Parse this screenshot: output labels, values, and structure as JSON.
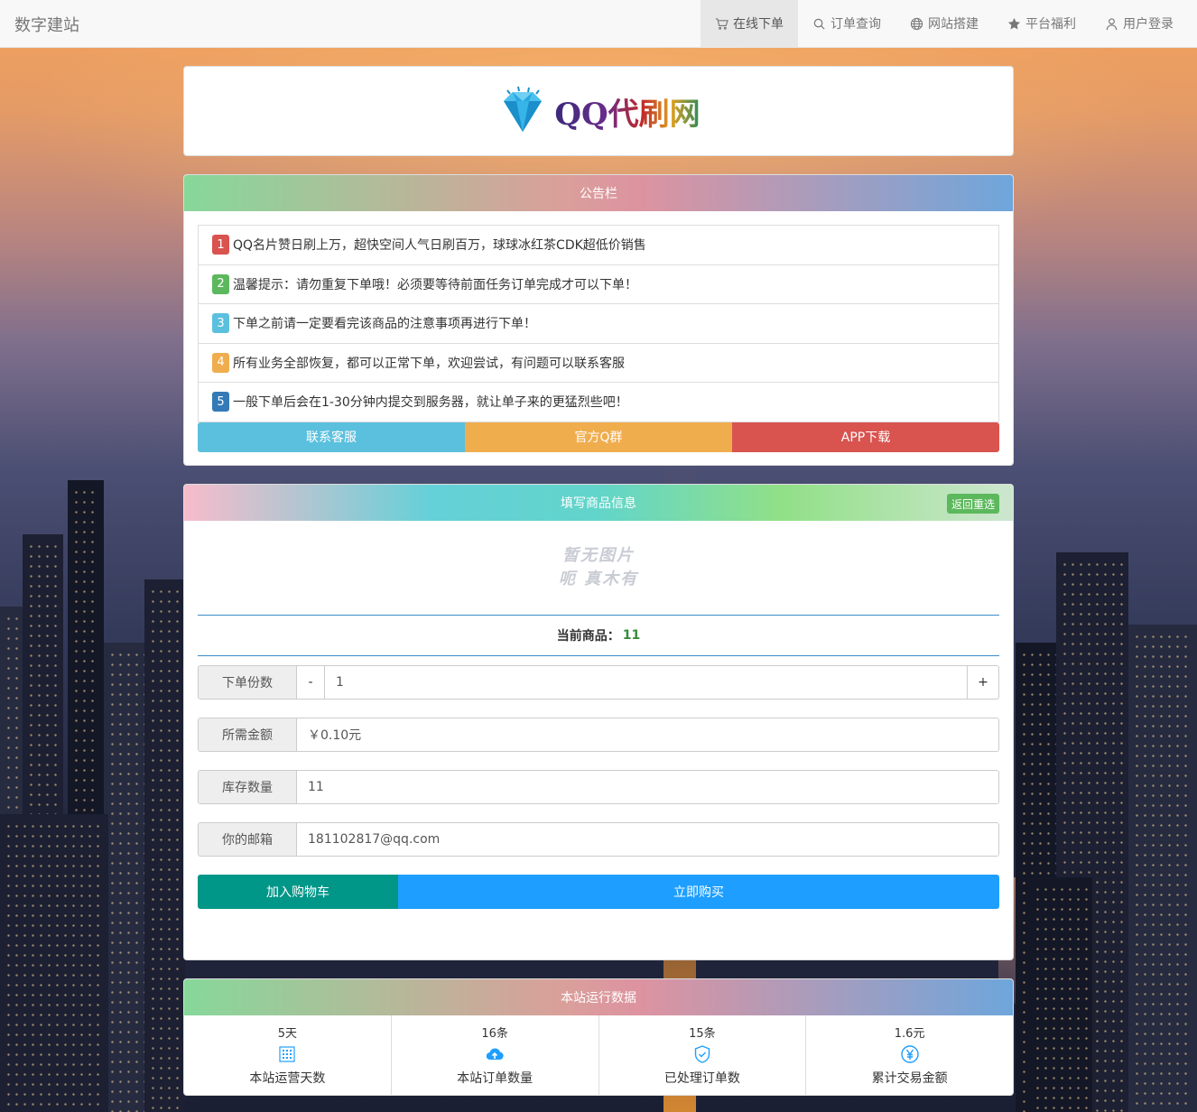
{
  "navbar": {
    "brand": "数字建站",
    "items": [
      {
        "label": "在线下单",
        "icon": "cart-icon",
        "active": true
      },
      {
        "label": "订单查询",
        "icon": "search-icon"
      },
      {
        "label": "网站搭建",
        "icon": "globe-icon"
      },
      {
        "label": "平台福利",
        "icon": "star-icon"
      },
      {
        "label": "用户登录",
        "icon": "user-icon"
      }
    ]
  },
  "logo": {
    "text": "QQ代刷网",
    "icon": "diamond-icon"
  },
  "notice": {
    "title": "公告栏",
    "items": [
      {
        "num": "1",
        "color": "#d9534f",
        "text": "QQ名片赞日刷上万，超快空间人气日刷百万，球球冰红茶CDK超低价销售"
      },
      {
        "num": "2",
        "color": "#5cb85c",
        "text": "温馨提示：请勿重复下单哦！必须要等待前面任务订单完成才可以下单！"
      },
      {
        "num": "3",
        "color": "#5bc0de",
        "text": "下单之前请一定要看完该商品的注意事项再进行下单！"
      },
      {
        "num": "4",
        "color": "#f0ad4e",
        "text": "所有业务全部恢复，都可以正常下单，欢迎尝试，有问题可以联系客服"
      },
      {
        "num": "5",
        "color": "#337ab7",
        "text": "一般下单后会在1-30分钟内提交到服务器，就让单子来的更猛烈些吧！"
      }
    ],
    "buttons": [
      {
        "label": "联系客服",
        "color": "#5bc0de"
      },
      {
        "label": "官方Q群",
        "color": "#f0ad4e"
      },
      {
        "label": "APP下载",
        "color": "#d9534f"
      }
    ]
  },
  "form": {
    "title": "填写商品信息",
    "reset_label": "返回重选",
    "noimg_line1": "暂无图片",
    "noimg_line2": "呃 真木有",
    "current_label": "当前商品：",
    "current_value": "11",
    "qty_label": "下单份数",
    "qty_minus": "-",
    "qty_value": "1",
    "qty_plus": "+",
    "price_label": "所需金额",
    "price_value": "￥0.10元",
    "stock_label": "库存数量",
    "stock_value": "11",
    "email_label": "你的邮箱",
    "email_value": "181102817@qq.com",
    "cart_label": "加入购物车",
    "buy_label": "立即购买"
  },
  "stats": {
    "title": "本站运行数据",
    "items": [
      {
        "value": "5天",
        "label": "本站运营天数",
        "icon": "calendar-icon"
      },
      {
        "value": "16条",
        "label": "本站订单数量",
        "icon": "cloud-upload-icon"
      },
      {
        "value": "15条",
        "label": "已处理订单数",
        "icon": "shield-check-icon"
      },
      {
        "value": "1.6元",
        "label": "累计交易金额",
        "icon": "yen-icon"
      }
    ]
  },
  "colors": {
    "accent": "#1e9fff",
    "cart": "#009688",
    "icon_blue": "#1e9fff"
  }
}
